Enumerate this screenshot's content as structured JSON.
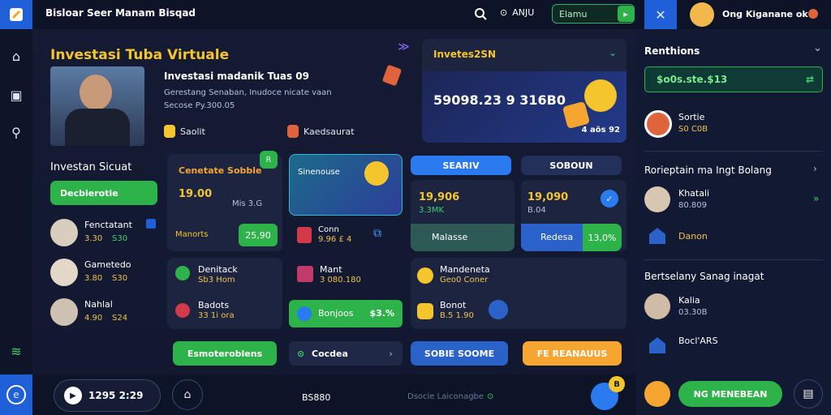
{
  "header": {
    "title": "Bisloar Seer Manam Bisqad",
    "points": "ANJU",
    "search_field": "Elamu",
    "user_name": "Ong Kiganane ok"
  },
  "hero": {
    "heading": "Investasi Tuba Virtuale",
    "info_title": "Investasi madanik Tuas 09",
    "info_line": "Gerestang Senaban, Inudoce nicate vaan",
    "info_price": "Secose Py.300.05",
    "tag1": "Saolit",
    "tag2": "Kaedsaurat"
  },
  "promo": {
    "title": "Invetes2SN",
    "amount": "59098.23 9 316B0",
    "badge": "4 aõs 92"
  },
  "left_panel": {
    "title": "Investan Sicuat",
    "button": "Decbierotie",
    "people": [
      {
        "name": "Fenctatant",
        "value1": "3.30",
        "value2": "S30"
      },
      {
        "name": "Gametedo",
        "value1": "3.80",
        "value2": "S30"
      },
      {
        "name": "Nahlal",
        "value1": "4.90",
        "value2": "S24"
      }
    ]
  },
  "grid": {
    "c1": {
      "title": "Cenetate Sobble",
      "badge": "R",
      "price": "19.00",
      "sub": "Mis 3.G",
      "tag": "25,90",
      "label": "Manorts"
    },
    "c2": {
      "title": "Sinenouse",
      "badge": "6",
      "item": "Conn",
      "item_val": "9.96 £ 4"
    },
    "c3": {
      "header": "SEARIV",
      "price": "19,906",
      "sub": "3.3MK",
      "label": "Malasse"
    },
    "c4": {
      "header": "SOBOUN",
      "price": "19,090",
      "sub": "B.04",
      "label": "Redesa",
      "pct": "13,0%"
    },
    "c5": {
      "title": "Denitack",
      "sub": "Sb3 Hom",
      "item": "Badots",
      "item_sub": "33 1i ora"
    },
    "c6": {
      "title": "Mant",
      "sub": "3 080.180",
      "label": "Bonjoos",
      "pct": "$3.%"
    },
    "c7": {
      "title": "Mandeneta",
      "sub": "Geo0 Coner",
      "item": "Bonot",
      "item_sub": "B.5 1.90"
    },
    "bot1": "Esmoteroblens",
    "bot2": "Cocdea",
    "bot3": "SOBIE SOOME",
    "bot4": "FE REANAUUS"
  },
  "right_panel": {
    "title": "Renthions",
    "input": "$o0s.ste.$13",
    "item1": "Sortie",
    "item1_sub": "S0 C0B",
    "section2": "Rorieptain ma Ingt Bolang",
    "p1": "Khatali",
    "p1_sub": "80.809",
    "p2": "Danon",
    "section3": "Bertselany Sanag inagat",
    "p3": "Kalia",
    "p3_sub": "03.30B",
    "p4": "Bocl'ARS",
    "cta": "NG MENEBEAN"
  },
  "footer": {
    "balance": "1295 2:29",
    "center": "BS880",
    "sub": "Dsocie Laiconagbe",
    "badge": "B"
  }
}
